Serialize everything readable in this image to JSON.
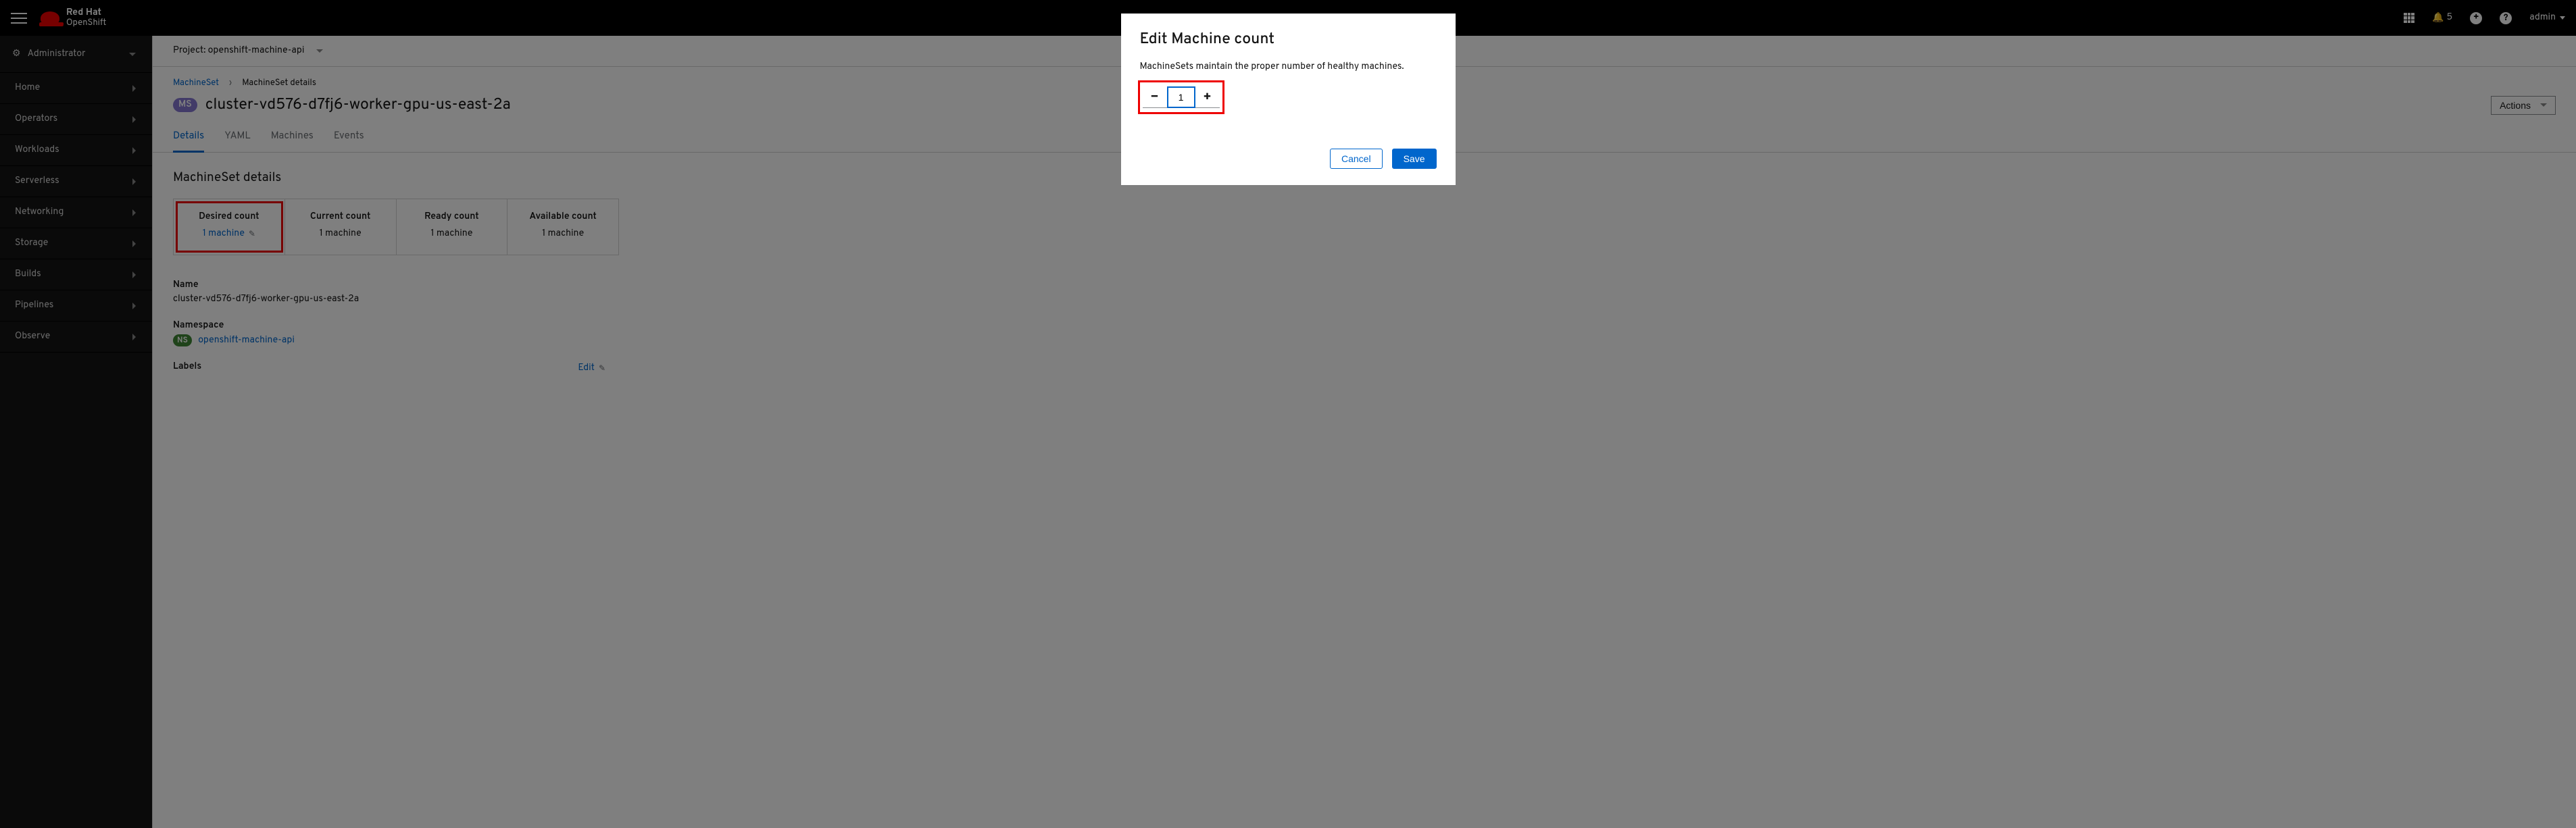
{
  "brand": {
    "top": "Red Hat",
    "bottom": "OpenShift"
  },
  "header": {
    "notification_count": "5",
    "user": "admin"
  },
  "sidebar": {
    "perspective": "Administrator",
    "items": [
      "Home",
      "Operators",
      "Workloads",
      "Serverless",
      "Networking",
      "Storage",
      "Builds",
      "Pipelines",
      "Observe"
    ]
  },
  "project": {
    "label": "Project:",
    "value": "openshift-machine-api"
  },
  "breadcrumb": {
    "parent": "MachineSet",
    "current": "MachineSet details"
  },
  "page": {
    "badge": "MS",
    "title": "cluster-vd576-d7fj6-worker-gpu-us-east-2a",
    "actions": "Actions"
  },
  "tabs": [
    "Details",
    "YAML",
    "Machines",
    "Events"
  ],
  "details": {
    "section_title": "MachineSet details",
    "cards": [
      {
        "label": "Desired count",
        "value": "1 machine",
        "link": true
      },
      {
        "label": "Current count",
        "value": "1 machine"
      },
      {
        "label": "Ready count",
        "value": "1 machine"
      },
      {
        "label": "Available count",
        "value": "1 machine"
      }
    ],
    "name_label": "Name",
    "name_value": "cluster-vd576-d7fj6-worker-gpu-us-east-2a",
    "namespace_label": "Namespace",
    "namespace_badge": "NS",
    "namespace_value": "openshift-machine-api",
    "labels_label": "Labels",
    "edit_label": "Edit"
  },
  "modal": {
    "title": "Edit Machine count",
    "description": "MachineSets maintain the proper number of healthy machines.",
    "value": "1",
    "cancel": "Cancel",
    "save": "Save"
  }
}
